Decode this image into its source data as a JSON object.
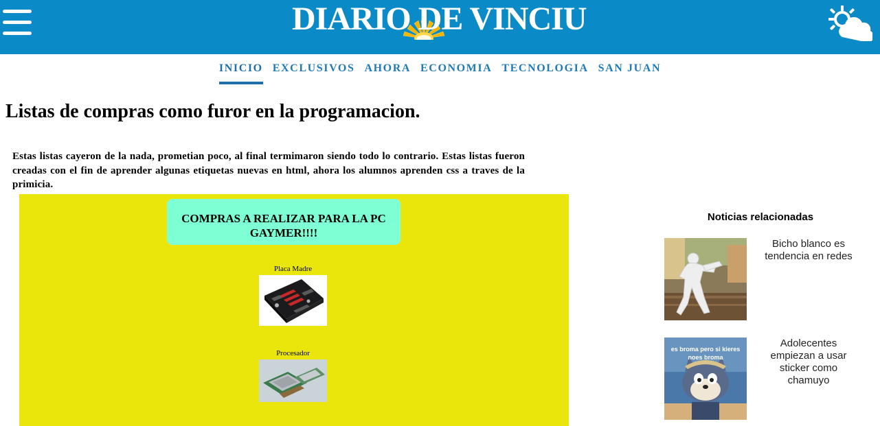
{
  "header": {
    "logo_text": "DIARIO DE VINCIU",
    "menu_icon": "hamburger-menu-icon",
    "weather_icon": "partly-sunny-icon",
    "brand_color": "#0a8ac6"
  },
  "nav": {
    "items": [
      {
        "label": "INICIO",
        "active": true
      },
      {
        "label": "EXCLUSIVOS",
        "active": false
      },
      {
        "label": "AHORA",
        "active": false
      },
      {
        "label": "ECONOMIA",
        "active": false
      },
      {
        "label": "TECNOLOGIA",
        "active": false
      },
      {
        "label": "SAN JUAN",
        "active": false
      }
    ],
    "color": "#1f7ab7"
  },
  "article": {
    "title": "Listas de compras como furor en la programacion.",
    "intro": "Estas listas cayeron de la nada, prometian poco, al final termimaron siendo todo lo contrario. Estas listas fueron creadas con el fin de aprender algunas etiquetas nuevas en html, ahora los alumnos aprenden css a traves de la primicia.",
    "list_box": {
      "title": "COMPRAS A REALIZAR PARA LA PC GAYMER!!!!",
      "background": "#eae60c",
      "title_background": "#7fffd4",
      "items": [
        {
          "label": "Placa Madre",
          "image": "motherboard-photo"
        },
        {
          "label": "Procesador",
          "image": "cpu-photo"
        }
      ]
    }
  },
  "sidebar": {
    "title": "Noticias relacionadas",
    "items": [
      {
        "text": "Bicho blanco es tendencia en redes",
        "image": "white-figure-meme-photo"
      },
      {
        "text": "Adolecentes empiezan a usar sticker como chamuyo",
        "image": "tom-cat-meme-photo",
        "image_caption": "es broma pero si kieres noes broma"
      }
    ]
  }
}
